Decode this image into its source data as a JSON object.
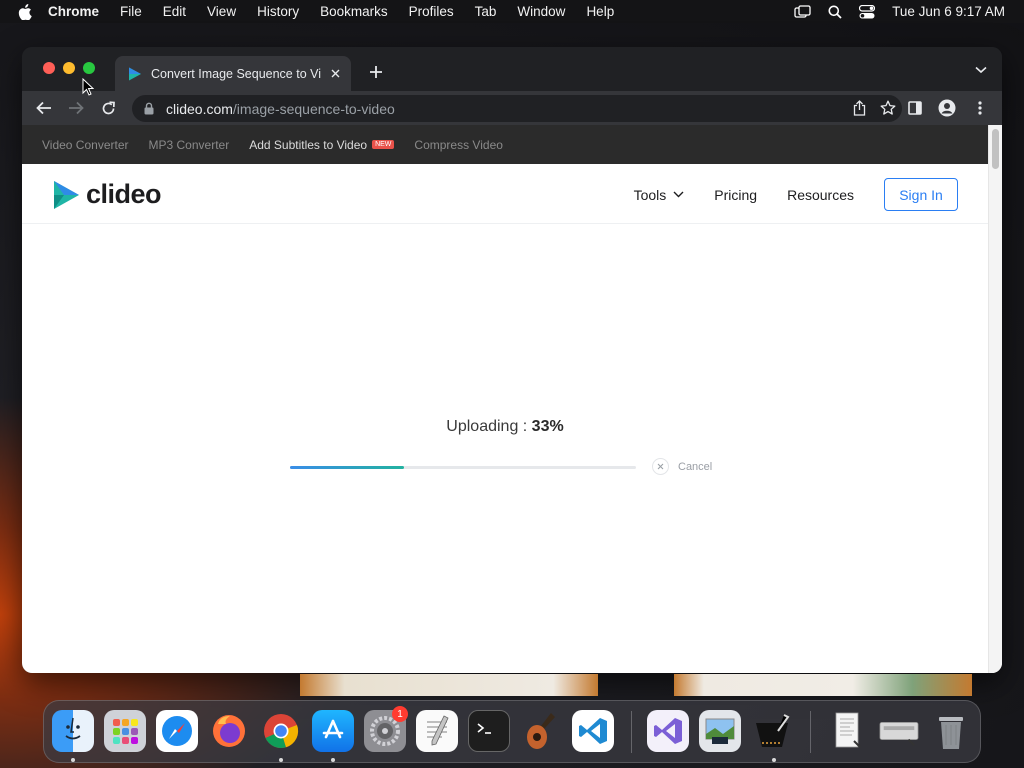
{
  "menubar": {
    "app_name": "Chrome",
    "items": [
      "File",
      "Edit",
      "View",
      "History",
      "Bookmarks",
      "Profiles",
      "Tab",
      "Window",
      "Help"
    ],
    "clock": "Tue Jun 6  9:17 AM"
  },
  "browser": {
    "tab_title": "Convert Image Sequence to Vi",
    "url_domain": "clideo.com",
    "url_path": "/image-sequence-to-video"
  },
  "site": {
    "top_links": [
      "Video Converter",
      "MP3 Converter",
      "Add Subtitles to Video",
      "Compress Video"
    ],
    "new_badge": "NEW",
    "logo_text": "clideo",
    "nav": {
      "tools": "Tools",
      "pricing": "Pricing",
      "resources": "Resources",
      "sign_in": "Sign In"
    },
    "upload": {
      "label": "Uploading : ",
      "percent_text": "33%",
      "progress": 0.33,
      "cancel": "Cancel"
    }
  },
  "dock": {
    "apps": [
      "finder-icon",
      "launchpad-icon",
      "safari-icon",
      "firefox-icon",
      "chrome-icon",
      "app-store-icon",
      "system-settings-icon",
      "textedit-icon",
      "terminal-icon",
      "garageband-icon",
      "vscode-icon",
      "visual-studio-icon",
      "preview-icon",
      "gimp-icon",
      "document-icon",
      "keyboard-icon",
      "trash-icon"
    ],
    "settings_badge": "1"
  },
  "colors": {
    "accent": "#2a7ef3",
    "progress_start": "#3a8de8",
    "progress_end": "#22b2a0",
    "new_badge": "#e8524a"
  }
}
